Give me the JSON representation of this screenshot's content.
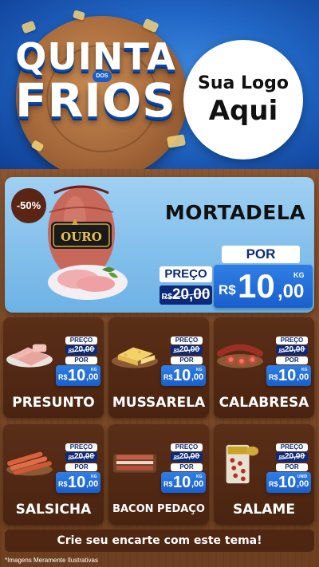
{
  "header": {
    "title_line1": "QUINTA",
    "title_small": "DOS",
    "title_line2": "FRIOS",
    "logo_line1": "Sua Logo",
    "logo_line2": "Aqui"
  },
  "featured": {
    "discount": "-50%",
    "name": "MORTADELA",
    "brand": "OURO",
    "price_label": "PREÇO",
    "old_currency": "R$",
    "old_price": "20,00",
    "por_label": "POR",
    "currency": "R$",
    "price_int": "10",
    "price_cents": ",00",
    "unit": "KG"
  },
  "products": [
    {
      "name": "PRESUNTO",
      "price_label": "PREÇO",
      "old_currency": "R$",
      "old_price": "20,00",
      "por_label": "POR",
      "currency": "R$",
      "price_int": "10",
      "price_cents": ",00",
      "unit": "KG"
    },
    {
      "name": "MUSSARELA",
      "price_label": "PREÇO",
      "old_currency": "R$",
      "old_price": "20,00",
      "por_label": "POR",
      "currency": "R$",
      "price_int": "10",
      "price_cents": ",00",
      "unit": "KG"
    },
    {
      "name": "CALABRESA",
      "price_label": "PREÇO",
      "old_currency": "R$",
      "old_price": "20,00",
      "por_label": "POR",
      "currency": "R$",
      "price_int": "10",
      "price_cents": ",00",
      "unit": "KG"
    },
    {
      "name": "SALSICHA",
      "price_label": "PREÇO",
      "old_currency": "R$",
      "old_price": "20,00",
      "por_label": "POR",
      "currency": "R$",
      "price_int": "10",
      "price_cents": ",00",
      "unit": "KG"
    },
    {
      "name": "BACON PEDAÇO",
      "price_label": "PREÇO",
      "old_currency": "R$",
      "old_price": "20,00",
      "por_label": "POR",
      "currency": "R$",
      "price_int": "10",
      "price_cents": ",00",
      "unit": "KG"
    },
    {
      "name": "SALAME",
      "price_label": "PREÇO",
      "old_currency": "R$",
      "old_price": "20,00",
      "por_label": "POR",
      "currency": "R$",
      "price_int": "10",
      "price_cents": ",00",
      "unit": "UNID"
    }
  ],
  "footer": {
    "cta": "Crie seu encarte com este tema!",
    "disclaimer": "*Imagens Meramente Ilustrativas"
  },
  "colors": {
    "header_blue": "#2268c6",
    "featured_bg": "#9fd0f2",
    "card_bg": "#5a2e17",
    "price_blue": "#1a5fcc",
    "label_navy": "#0d2a7a"
  }
}
